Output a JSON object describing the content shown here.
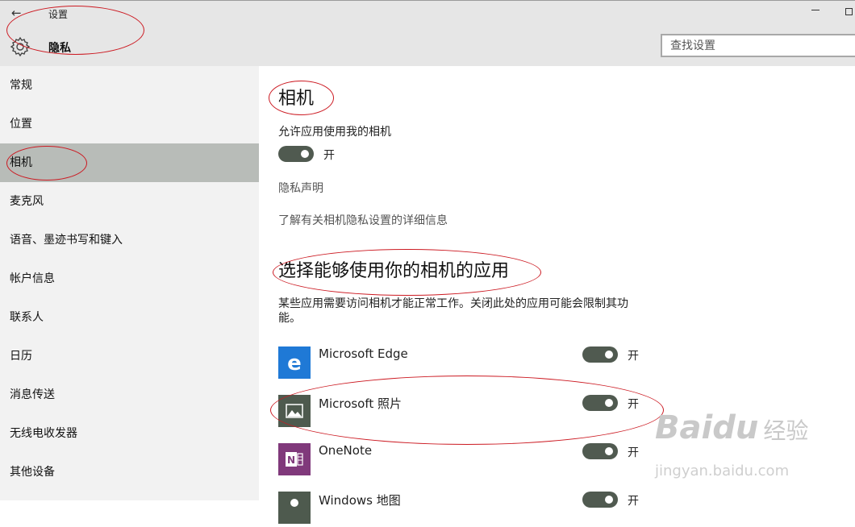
{
  "window": {
    "back_glyph": "←",
    "title": "设置"
  },
  "header": {
    "page_title": "隐私",
    "search_placeholder": "查找设置"
  },
  "sidebar": {
    "items": [
      {
        "label": "常规"
      },
      {
        "label": "位置"
      },
      {
        "label": "相机",
        "active": true
      },
      {
        "label": "麦克风"
      },
      {
        "label": "语音、墨迹书写和键入"
      },
      {
        "label": "帐户信息"
      },
      {
        "label": "联系人"
      },
      {
        "label": "日历"
      },
      {
        "label": "消息传送"
      },
      {
        "label": "无线电收发器"
      },
      {
        "label": "其他设备"
      }
    ]
  },
  "main": {
    "heading": "相机",
    "allow_label": "允许应用使用我的相机",
    "allow_toggle": {
      "state": "on",
      "text": "开"
    },
    "privacy_link": "隐私声明",
    "learn_more_link": "了解有关相机隐私设置的详细信息",
    "apps_heading": "选择能够使用你的相机的应用",
    "apps_description": "某些应用需要访问相机才能正常工作。关闭此处的应用可能会限制其功能。",
    "apps": [
      {
        "name": "Microsoft Edge",
        "icon": "edge-icon",
        "icon_color": "#1f79d6",
        "toggle": "on",
        "toggle_text": "开"
      },
      {
        "name": "Microsoft 照片",
        "icon": "photos-icon",
        "icon_color": "#4e5a4e",
        "toggle": "on",
        "toggle_text": "开"
      },
      {
        "name": "OneNote",
        "icon": "onenote-icon",
        "icon_color": "#80397b",
        "toggle": "on",
        "toggle_text": "开"
      },
      {
        "name": "Windows 地图",
        "icon": "maps-icon",
        "icon_color": "#4e5a4e",
        "toggle": "on",
        "toggle_text": "开"
      }
    ]
  },
  "colors": {
    "toggle_on": "#505a50",
    "sidebar_active": "#b8bcb8",
    "annotation": "#cc1a22"
  },
  "watermark": {
    "logo": "Baidu",
    "brand_cn": "经验",
    "url": "jingyan.baidu.com"
  }
}
